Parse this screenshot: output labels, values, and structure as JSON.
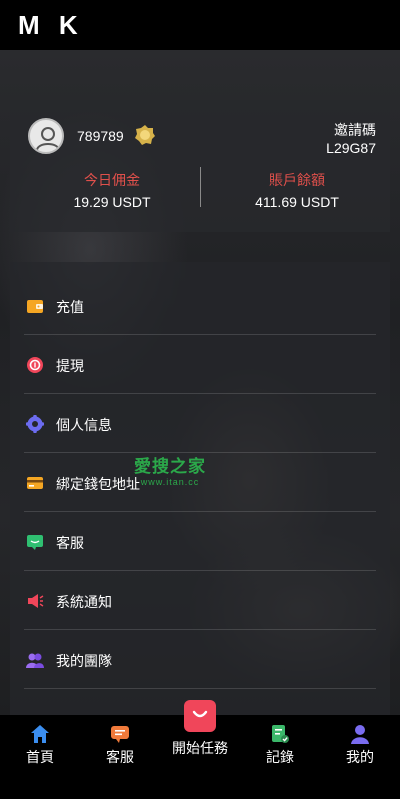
{
  "header": {
    "logo": "M K"
  },
  "profile": {
    "username": "789789",
    "invite_label": "邀請碼",
    "invite_code": "L29G87",
    "today_commission_label": "今日佣金",
    "today_commission_value": "19.29 USDT",
    "balance_label": "賬戶餘額",
    "balance_value": "411.69 USDT"
  },
  "menu": {
    "items": [
      {
        "label": "充值",
        "icon": "wallet-icon",
        "color": "#f5a623"
      },
      {
        "label": "提現",
        "icon": "withdraw-icon",
        "color": "#f0465a"
      },
      {
        "label": "個人信息",
        "icon": "settings-icon",
        "color": "#6c6cf0"
      },
      {
        "label": "綁定錢包地址",
        "icon": "card-icon",
        "color": "#f5a623"
      },
      {
        "label": "客服",
        "icon": "chat-icon",
        "color": "#2fbf71"
      },
      {
        "label": "系統通知",
        "icon": "megaphone-icon",
        "color": "#f0465a"
      },
      {
        "label": "我的團隊",
        "icon": "team-icon",
        "color": "#9a6cf0"
      }
    ]
  },
  "watermark": {
    "line1": "愛搜之家",
    "line2": "www.itan.cc"
  },
  "tabbar": {
    "tabs": [
      {
        "label": "首頁",
        "icon": "home-icon",
        "color": "#3b8ef0"
      },
      {
        "label": "客服",
        "icon": "chat-icon",
        "color": "#f07a3b"
      },
      {
        "label": "開始任務",
        "icon": "bag-icon",
        "color": "#f0465a"
      },
      {
        "label": "記錄",
        "icon": "record-icon",
        "color": "#3bb86a"
      },
      {
        "label": "我的",
        "icon": "user-icon",
        "color": "#7a6cf0"
      }
    ]
  }
}
